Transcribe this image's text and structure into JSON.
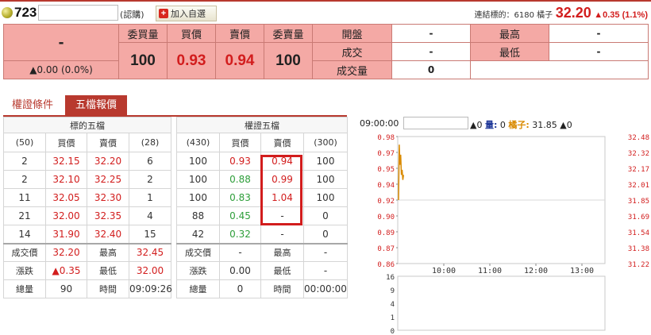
{
  "header": {
    "code": "723",
    "type_label": "(認購)",
    "add_button_label": "加入自選",
    "link_label": "連結標的：6180 橘子",
    "link_price": "32.20",
    "link_change": "▲0.35 (1.1%)"
  },
  "summary": {
    "last": "-",
    "change": "▲0.00 (0.0%)",
    "headers": [
      "委買量",
      "買價",
      "賣價",
      "委賣量"
    ],
    "bid_qty": "100",
    "bid": "0.93",
    "ask": "0.94",
    "ask_qty": "100",
    "stats": [
      {
        "label": "開盤",
        "value": "-",
        "label2": "最高",
        "value2": "-"
      },
      {
        "label": "成交",
        "value": "-",
        "label2": "最低",
        "value2": "-"
      },
      {
        "label": "成交量",
        "value": "0",
        "label2": "",
        "value2": ""
      }
    ]
  },
  "tabs": [
    "權證條件",
    "五檔報價"
  ],
  "left_book": {
    "title": "標的五檔",
    "head": [
      "(50)",
      "買價",
      "賣價",
      "(28)"
    ],
    "rows": [
      [
        "2",
        "32.15",
        "32.20",
        "6"
      ],
      [
        "2",
        "32.10",
        "32.25",
        "2"
      ],
      [
        "11",
        "32.05",
        "32.30",
        "1"
      ],
      [
        "21",
        "32.00",
        "32.35",
        "4"
      ],
      [
        "14",
        "31.90",
        "32.40",
        "15"
      ]
    ],
    "footer": [
      [
        "成交價",
        "32.20",
        "最高",
        "32.45"
      ],
      [
        "漲跌",
        "▲0.35",
        "最低",
        "32.00"
      ],
      [
        "總量",
        "90",
        "時間",
        "09:09:26"
      ]
    ]
  },
  "right_book": {
    "title": "權證五檔",
    "head": [
      "(430)",
      "買價",
      "賣價",
      "(300)"
    ],
    "rows": [
      [
        "100",
        "0.93",
        "0.94",
        "100"
      ],
      [
        "100",
        "0.88",
        "0.99",
        "100"
      ],
      [
        "100",
        "0.83",
        "1.04",
        "100"
      ],
      [
        "88",
        "0.45",
        "-",
        "0"
      ],
      [
        "42",
        "0.32",
        "-",
        "0"
      ]
    ],
    "footer": [
      [
        "成交價",
        "-",
        "最高",
        "-"
      ],
      [
        "漲跌",
        "0.00",
        "最低",
        "-"
      ],
      [
        "總量",
        "0",
        "時間",
        "00:00:00"
      ]
    ]
  },
  "chart": {
    "time": "09:00:00",
    "info_change": "▲0",
    "info_vol_label": "量:",
    "info_vol": "0",
    "info_under_label": "橘子:",
    "info_under_price": "31.85",
    "info_under_change": "▲0"
  },
  "chart_data": {
    "type": "line",
    "left_ticks": [
      "0.98",
      "0.97",
      "0.95",
      "0.94",
      "0.92",
      "0.90",
      "0.89",
      "0.87",
      "0.86"
    ],
    "right_ticks": [
      "32.48",
      "32.32",
      "32.17",
      "32.01",
      "31.85",
      "31.69",
      "31.54",
      "31.38",
      "31.22"
    ],
    "x_ticks": [
      "10:00",
      "11:00",
      "12:00",
      "13:00"
    ],
    "vol_ticks": [
      "16",
      "9",
      "4",
      "1",
      "0"
    ],
    "ylim_left": [
      0.86,
      0.98
    ],
    "series": [
      {
        "values": [
          31.85,
          32.4,
          32.2,
          32.3,
          32.1,
          32.15,
          32.05,
          32.1
        ]
      }
    ],
    "grid": true
  },
  "colors": {
    "accent": "#b8392e",
    "up": "#d21d1d",
    "down": "#2e9e3a",
    "highlight": "#f4a9a5",
    "underlying_line": "#d98a00"
  }
}
